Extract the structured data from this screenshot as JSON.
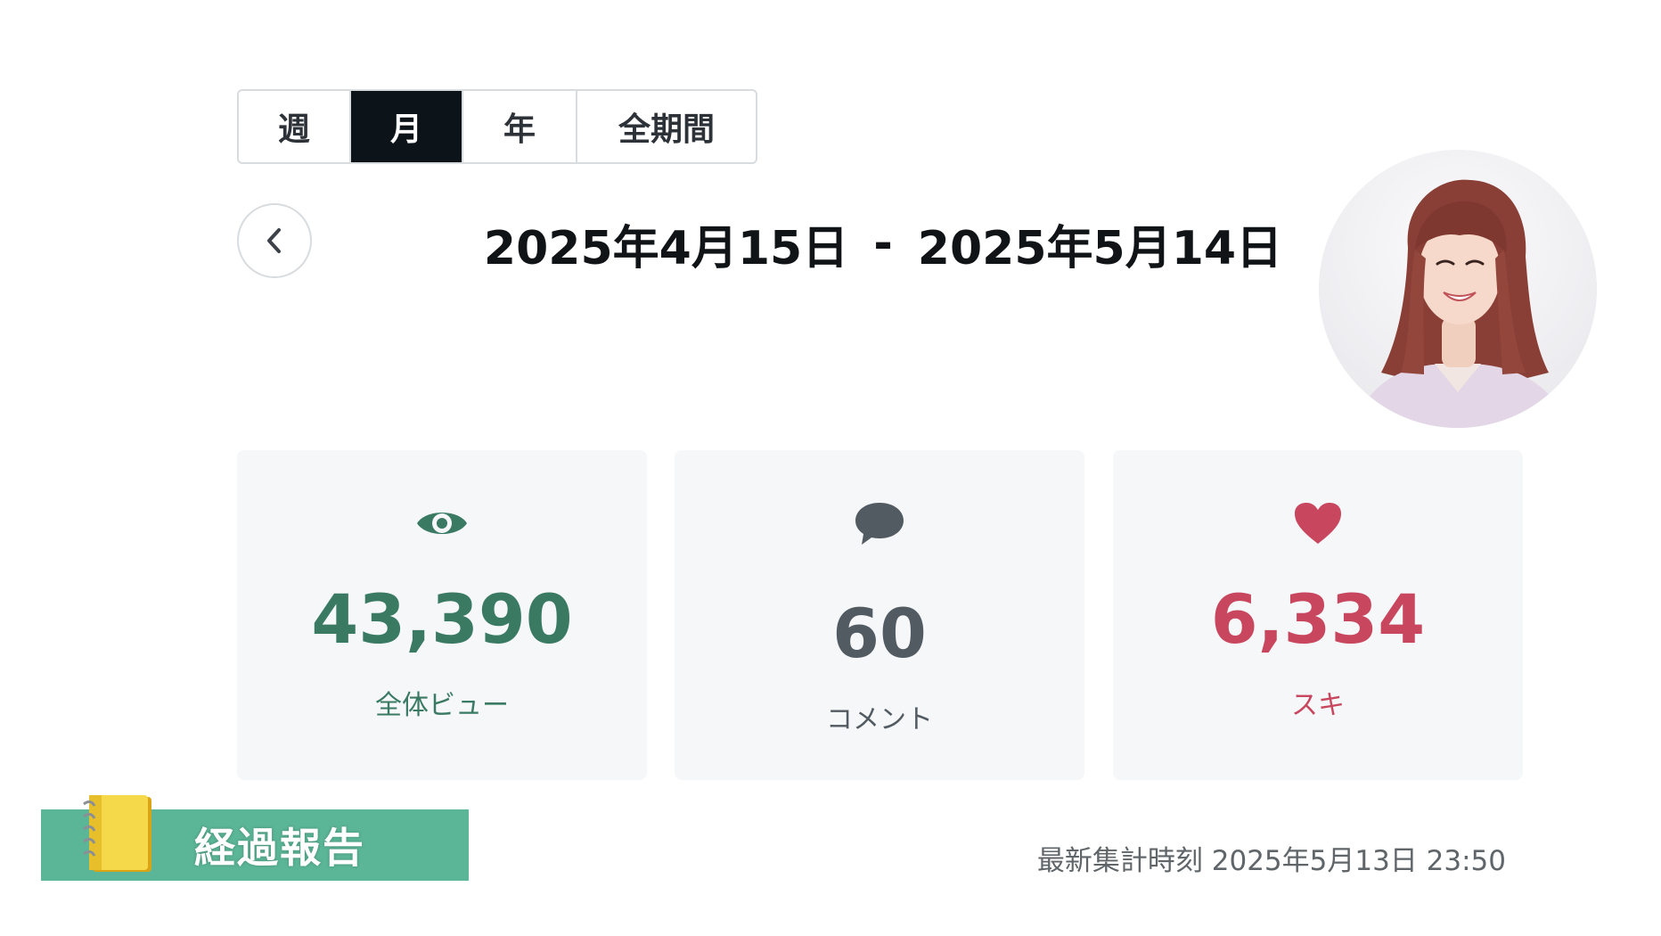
{
  "tabs": [
    {
      "label": "週",
      "active": false
    },
    {
      "label": "月",
      "active": true
    },
    {
      "label": "年",
      "active": false
    },
    {
      "label": "全期間",
      "active": false
    }
  ],
  "date_range": {
    "start": "2025年4月15日",
    "separator": "-",
    "end": "2025年5月14日"
  },
  "stats": {
    "views": {
      "value": "43,390",
      "label": "全体ビュー",
      "icon": "eye-icon",
      "color": "#3a7a63"
    },
    "comments": {
      "value": "60",
      "label": "コメント",
      "icon": "speech-bubble-icon",
      "color": "#525a62"
    },
    "likes": {
      "value": "6,334",
      "label": "スキ",
      "icon": "heart-icon",
      "color": "#c8465e"
    }
  },
  "banner": {
    "title": "経過報告",
    "icon": "notebook-icon",
    "background": "#5bb597"
  },
  "timestamp": "最新集計時刻 2025年5月13日 23:50",
  "avatar": {
    "icon": "user-photo"
  }
}
